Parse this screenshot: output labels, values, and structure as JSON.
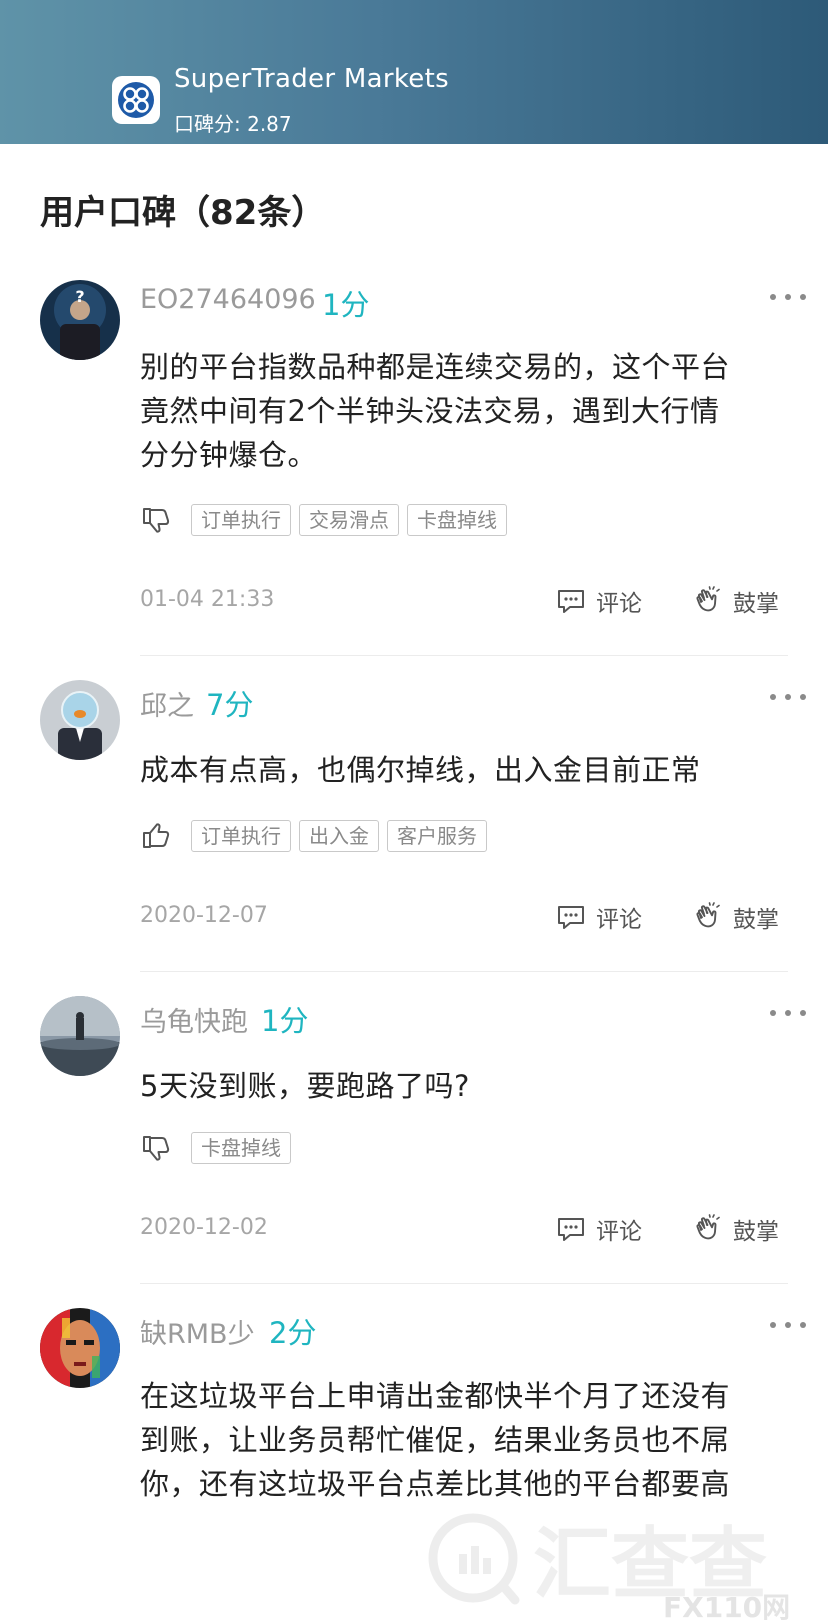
{
  "header": {
    "broker_name": "SuperTrader Markets",
    "score_text": "口碑分: 2.87",
    "logo_icon": "clover-logo-icon",
    "gradient_from": "#5f93a8",
    "gradient_to": "#2d5a78"
  },
  "section": {
    "title": "用户口碑（82条）"
  },
  "colors": {
    "accent": "#1fb5c0",
    "muted": "#9a9a9a"
  },
  "reviews": [
    {
      "username": "EO27464096",
      "score": "1分",
      "lines": [
        "别的平台指数品种都是连续交易的，这个平台",
        "竟然中间有2个半钟头没法交易，遇到大行情",
        "分分钟爆仓。"
      ],
      "sentiment_icon": "thumbs-down-icon",
      "tags": [
        "订单执行",
        "交易滑点",
        "卡盘掉线"
      ],
      "date": "01-04 21:33",
      "comment_label": "评论",
      "clap_label": "鼓掌"
    },
    {
      "username": "邱之",
      "score": "7分",
      "lines": [
        "成本有点高，也偶尔掉线，出入金目前正常"
      ],
      "sentiment_icon": "thumbs-up-icon",
      "tags": [
        "订单执行",
        "出入金",
        "客户服务"
      ],
      "date": "2020-12-07",
      "comment_label": "评论",
      "clap_label": "鼓掌"
    },
    {
      "username": "乌龟快跑",
      "score": "1分",
      "lines": [
        "5天没到账，要跑路了吗?"
      ],
      "sentiment_icon": "thumbs-down-icon",
      "tags": [
        "卡盘掉线"
      ],
      "date": "2020-12-02",
      "comment_label": "评论",
      "clap_label": "鼓掌"
    },
    {
      "username": "缺RMB少",
      "score": "2分",
      "lines": [
        "在这垃圾平台上申请出金都快半个月了还没有",
        "到账，让业务员帮忙催促，结果业务员也不屌",
        "你，还有这垃圾平台点差比其他的平台都要高"
      ],
      "sentiment_icon": "none",
      "tags": [],
      "date": "",
      "comment_label": "",
      "clap_label": ""
    }
  ],
  "watermark": {
    "text": "汇查查",
    "suffix": "FX110网"
  }
}
